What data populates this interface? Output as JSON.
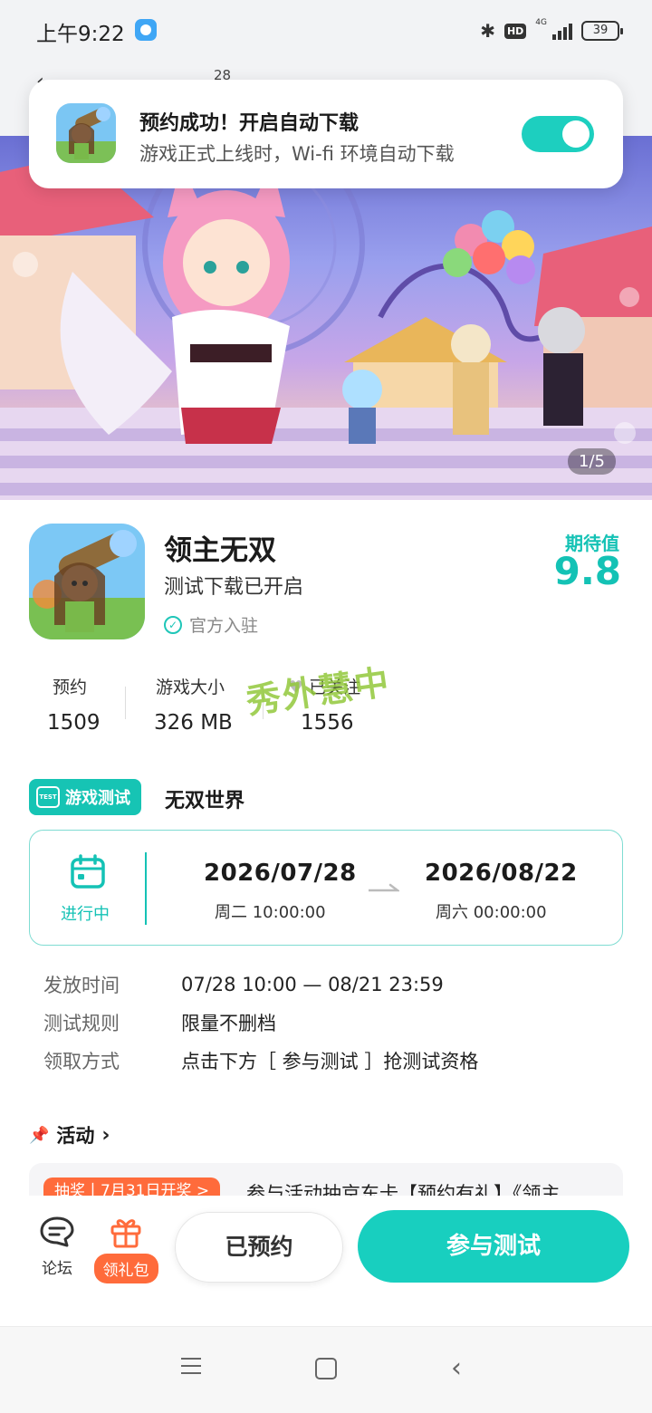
{
  "status_bar": {
    "time": "上午9:22",
    "network": "4G",
    "hd": "HD",
    "battery": "39"
  },
  "header": {
    "count": "28"
  },
  "toast": {
    "title": "预约成功！开启自动下载",
    "subtitle": "游戏正式上线时，Wi-fi 环境自动下载",
    "toggle_on": true
  },
  "banner": {
    "counter": "1/5"
  },
  "game": {
    "name": "领主无双",
    "status": "测试下载已开启",
    "official": "官方入驻",
    "expect_label": "期待值",
    "expect_value": "9.8"
  },
  "stats": [
    {
      "label": "预约",
      "value": "1509"
    },
    {
      "label": "游戏大小",
      "value": "326 MB"
    },
    {
      "label": "已关注",
      "value": "1556"
    }
  ],
  "watermark": "秀外慧中",
  "test": {
    "tag": "游戏测试",
    "tag_icon": "TEST",
    "name": "无双世界",
    "state": "进行中",
    "start_date": "2026/07/28",
    "start_sub": "周二   10:00:00",
    "end_date": "2026/08/22",
    "end_sub": "周六   00:00:00",
    "rows": [
      {
        "label": "发放时间",
        "value": "07/28 10:00 — 08/21 23:59"
      },
      {
        "label": "测试规则",
        "value": "限量不删档"
      },
      {
        "label": "领取方式",
        "value": "点击下方［ 参与测试 ］抢测试资格"
      }
    ]
  },
  "activity": {
    "title": "活动",
    "badge": "抽奖丨7月31日开奖 >",
    "text": "参与活动抽京东卡【预约有礼】《领主"
  },
  "actions": {
    "forum": "论坛",
    "gift": "领礼包",
    "reserved": "已预约",
    "join": "参与测试"
  },
  "colors": {
    "accent": "#18cfbf",
    "orange": "#ff6b3b"
  }
}
